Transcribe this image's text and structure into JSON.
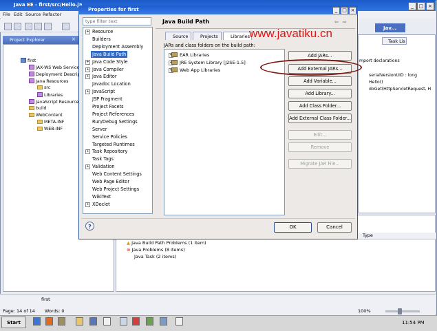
{
  "ide": {
    "title": "Java EE - first/src/Hello.ja",
    "menu": [
      "File",
      "Edit",
      "Source",
      "Refactor"
    ],
    "project_explorer": {
      "title": "Project Explorer",
      "tree": [
        {
          "label": "first",
          "indent": 0
        },
        {
          "label": "JAX-WS Web Service",
          "indent": 1
        },
        {
          "label": "Deployment Descript",
          "indent": 1
        },
        {
          "label": "Java Resources",
          "indent": 1
        },
        {
          "label": "src",
          "indent": 2
        },
        {
          "label": "Libraries",
          "indent": 2
        },
        {
          "label": "JavaScript Resource",
          "indent": 1
        },
        {
          "label": "build",
          "indent": 1
        },
        {
          "label": "WebContent",
          "indent": 1
        },
        {
          "label": "META-INF",
          "indent": 2
        },
        {
          "label": "WEB-INF",
          "indent": 2
        }
      ]
    },
    "editor_tab": "Jav...",
    "task_list_tab": "Task Lis",
    "outline": [
      "mport declarations",
      "serialVersionUID : long",
      "Hello()",
      "doGet(HttpServletRequest, H"
    ],
    "problems": {
      "type_header": "Type",
      "rows": [
        "Java Build Path Problems (1 item)",
        "Java Problems (8 items)",
        "Java Task (2 items)"
      ]
    },
    "status": {
      "page": "Page: 14 of 14",
      "words": "Words: 0",
      "project": "first",
      "zoom": "100%"
    }
  },
  "dialog": {
    "title": "Properties for first",
    "filter_placeholder": "type filter text",
    "nav": [
      {
        "label": "Resource",
        "expandable": true
      },
      {
        "label": "Builders",
        "expandable": false
      },
      {
        "label": "Deployment Assembly",
        "expandable": false
      },
      {
        "label": "Java Build Path",
        "expandable": false,
        "selected": true
      },
      {
        "label": "Java Code Style",
        "expandable": true
      },
      {
        "label": "Java Compiler",
        "expandable": true
      },
      {
        "label": "Java Editor",
        "expandable": true
      },
      {
        "label": "Javadoc Location",
        "expandable": false
      },
      {
        "label": "JavaScript",
        "expandable": true
      },
      {
        "label": "JSP Fragment",
        "expandable": false
      },
      {
        "label": "Project Facets",
        "expandable": false
      },
      {
        "label": "Project References",
        "expandable": false
      },
      {
        "label": "Run/Debug Settings",
        "expandable": false
      },
      {
        "label": "Server",
        "expandable": false
      },
      {
        "label": "Service Policies",
        "expandable": false
      },
      {
        "label": "Targeted Runtimes",
        "expandable": false
      },
      {
        "label": "Task Repository",
        "expandable": true
      },
      {
        "label": "Task Tags",
        "expandable": false
      },
      {
        "label": "Validation",
        "expandable": true
      },
      {
        "label": "Web Content Settings",
        "expandable": false
      },
      {
        "label": "Web Page Editor",
        "expandable": false
      },
      {
        "label": "Web Project Settings",
        "expandable": false
      },
      {
        "label": "WikiText",
        "expandable": false
      },
      {
        "label": "XDoclet",
        "expandable": true
      }
    ],
    "page_title": "Java Build Path",
    "tabs": [
      "Source",
      "Projects",
      "Libraries"
    ],
    "jars_label": "JARs and class folders on the build path:",
    "jars": [
      "EAR Libraries",
      "JRE System Library [J2SE-1.5]",
      "Web App Libraries"
    ],
    "buttons": {
      "add_jars": "Add JARs...",
      "add_external_jars": "Add External JARs...",
      "add_variable": "Add Variable...",
      "add_library": "Add Library...",
      "add_class_folder": "Add Class Folder...",
      "add_external_class_folder": "Add External Class Folder...",
      "edit": "Edit...",
      "remove": "Remove",
      "migrate_jar": "Migrate JAR File..."
    },
    "ok": "OK",
    "cancel": "Cancel",
    "help": "?"
  },
  "watermark": "www.javatiku.cn",
  "taskbar": {
    "start": "Start",
    "clock": "11:54 PM"
  }
}
